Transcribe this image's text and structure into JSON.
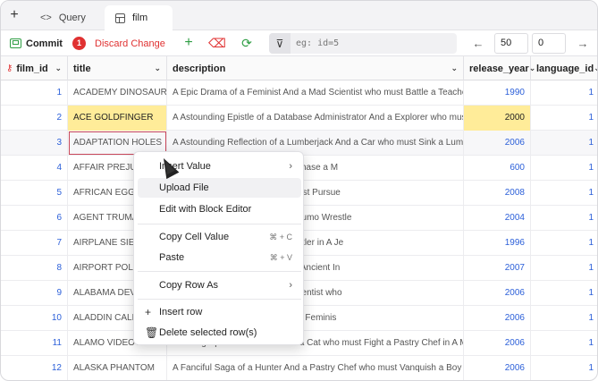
{
  "tabs": {
    "add_glyph": "+",
    "items": [
      {
        "label": "Query",
        "icon": "code-icon",
        "glyph": "<>"
      },
      {
        "label": "film",
        "icon": "table-icon"
      }
    ]
  },
  "toolbar": {
    "commit_label": "Commit",
    "commit_badge": "1",
    "discard_label": "Discard Change",
    "add_row_glyph": "+",
    "delete_row_glyph": "⌫",
    "refresh_glyph": "⟳",
    "filter_glyph": "⊽",
    "filter_placeholder": "eg: id=5",
    "prev_glyph": "←",
    "next_glyph": "→",
    "limit": "50",
    "offset": "0"
  },
  "columns": [
    {
      "name": "film_id",
      "key": true
    },
    {
      "name": "title"
    },
    {
      "name": "description"
    },
    {
      "name": "release_year"
    },
    {
      "name": "language_id"
    }
  ],
  "header_arrow": "⌄",
  "key_glyph": "⚷",
  "rows": [
    {
      "film_id": "1",
      "title": "ACADEMY DINOSAUR",
      "description": "A Epic Drama of a Feminist And a Mad Scientist who must Battle a Teacher in",
      "release_year": "1990",
      "language_id": "1"
    },
    {
      "film_id": "2",
      "title": "ACE GOLDFINGER",
      "description": "A Astounding Epistle of a Database Administrator And a Explorer who must F",
      "release_year": "2000",
      "language_id": "1"
    },
    {
      "film_id": "3",
      "title": "ADAPTATION HOLES",
      "description": "A Astounding Reflection of a Lumberjack And a Car who must Sink a Lumberj",
      "release_year": "2006",
      "language_id": "1"
    },
    {
      "film_id": "4",
      "title": "AFFAIR PREJUD",
      "description": "e And a Lumberjack who must Chase a M",
      "release_year": "600",
      "language_id": "1"
    },
    {
      "film_id": "5",
      "title": "AFRICAN EGG H",
      "description": "astry Chef And a Dentist who must Pursue",
      "release_year": "2008",
      "language_id": "1"
    },
    {
      "film_id": "6",
      "title": "AGENT TRUMAI",
      "description": "and a Boy who must Escape a Sumo Wrestle",
      "release_year": "2004",
      "language_id": "1"
    },
    {
      "film_id": "7",
      "title": "AIRPLANE SIERI",
      "description": "a Butler who must Discover a Butler in A Je",
      "release_year": "1996",
      "language_id": "1"
    },
    {
      "film_id": "8",
      "title": "AIRPORT POLLO",
      "description": "who must Confront a Monkey in Ancient In",
      "release_year": "2007",
      "language_id": "1"
    },
    {
      "film_id": "9",
      "title": "ALABAMA DEVI",
      "description": "ase Administrator And a Mad Scientist who",
      "release_year": "2006",
      "language_id": "1"
    },
    {
      "film_id": "10",
      "title": "ALADDIN CALE",
      "description": "a Lumberjack who must Reach a Feminis",
      "release_year": "2006",
      "language_id": "1"
    },
    {
      "film_id": "11",
      "title": "ALAMO VIDEOTAPE",
      "description": "A Boring Epistle of a Butler And a Cat who must Fight a Pastry Chef in A MyS",
      "release_year": "2006",
      "language_id": "1"
    },
    {
      "film_id": "12",
      "title": "ALASKA PHANTOM",
      "description": "A Fanciful Saga of a Hunter And a Pastry Chef who must Vanquish a Boy in A",
      "release_year": "2006",
      "language_id": "1"
    }
  ],
  "context_menu": {
    "items": [
      {
        "label": "Insert Value",
        "submenu": true,
        "chevron": "›"
      },
      {
        "label": "Upload File"
      },
      {
        "label": "Edit with Block Editor"
      },
      {
        "label": "Copy Cell Value",
        "shortcut": "⌘ + C"
      },
      {
        "label": "Paste",
        "shortcut": "⌘ + V"
      },
      {
        "label": "Copy Row As",
        "submenu": true,
        "chevron": "›"
      },
      {
        "label": "Insert row",
        "glyph": "+"
      },
      {
        "label": "Delete selected row(s)",
        "glyph": "🗑"
      }
    ]
  }
}
